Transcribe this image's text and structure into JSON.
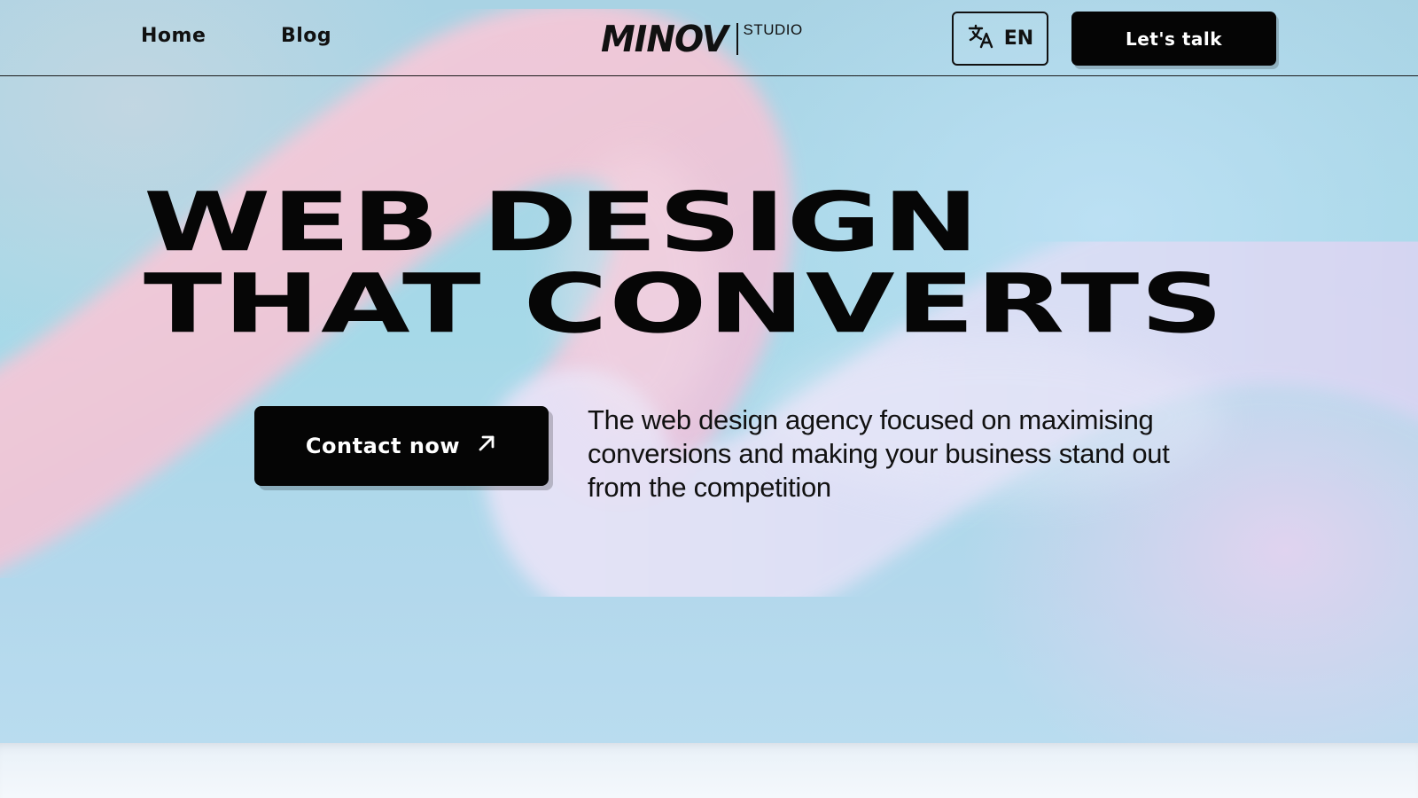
{
  "nav": {
    "items": [
      {
        "label": "Home"
      },
      {
        "label": "Blog"
      }
    ]
  },
  "logo": {
    "wordmark": "MINOV",
    "suffix": "STUDIO"
  },
  "language": {
    "label": "EN",
    "icon": "translate-icon"
  },
  "header_cta": {
    "label": "Let's talk"
  },
  "hero": {
    "headline_line1": "WEB DESIGN",
    "headline_line2": "THAT CONVERTS",
    "cta_label": "Contact now",
    "cta_icon": "arrow-up-right-icon",
    "tagline": "The web design agency focused on maximising conversions and making your business stand out from the competition"
  },
  "colors": {
    "text": "#111111",
    "button_bg": "#050505",
    "button_text": "#ffffff",
    "blob_pink": "#f6c9d8",
    "blob_lavender": "#dcd6f4",
    "background_blue": "#a8d6e6"
  }
}
